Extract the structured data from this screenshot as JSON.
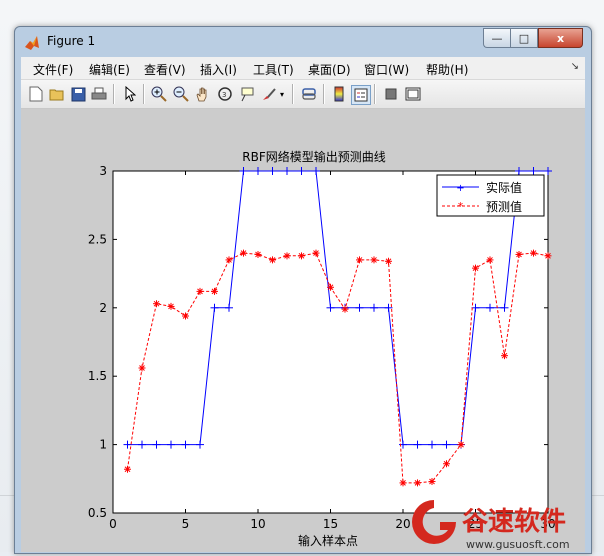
{
  "window": {
    "title": "Figure 1",
    "controls": {
      "minimize": "—",
      "maximize": "□",
      "close": "x"
    }
  },
  "menubar": {
    "items": [
      {
        "label": "文件(F)"
      },
      {
        "label": "编辑(E)"
      },
      {
        "label": "查看(V)"
      },
      {
        "label": "插入(I)"
      },
      {
        "label": "工具(T)"
      },
      {
        "label": "桌面(D)"
      },
      {
        "label": "窗口(W)"
      },
      {
        "label": "帮助(H)"
      }
    ],
    "overflow": "↘"
  },
  "toolbar": {
    "icons": [
      "new-file-icon",
      "open-icon",
      "save-icon",
      "print-icon",
      "pointer-icon",
      "zoom-in-icon",
      "zoom-out-icon",
      "pan-hand-icon",
      "rotate-3d-icon",
      "data-cursor-icon",
      "brush-icon",
      "link-icon",
      "colorbar-icon",
      "legend-icon",
      "hide-plot-tools-icon",
      "show-plot-tools-icon"
    ]
  },
  "watermark": {
    "brand": "谷速软件",
    "url": "www.gusuosft.com"
  },
  "chart_data": {
    "type": "line",
    "title": "RBF网络模型输出预测曲线",
    "xlabel": "输入样本点",
    "ylabel": "",
    "xlim": [
      0,
      30
    ],
    "ylim": [
      0.5,
      3
    ],
    "xticks": [
      "0",
      "5",
      "10",
      "15",
      "20",
      "25",
      "30"
    ],
    "yticks": [
      "0.5",
      "1",
      "1.5",
      "2",
      "2.5",
      "3"
    ],
    "grid": false,
    "legend_position": "top-right",
    "x": [
      1,
      2,
      3,
      4,
      5,
      6,
      7,
      8,
      9,
      10,
      11,
      12,
      13,
      14,
      15,
      16,
      17,
      18,
      19,
      20,
      21,
      22,
      23,
      24,
      25,
      26,
      27,
      28,
      29,
      30
    ],
    "series": [
      {
        "name": "实际值",
        "color": "#0000ff",
        "style": "solid",
        "marker": "+",
        "values": [
          1,
          1,
          1,
          1,
          1,
          1,
          2,
          2,
          3,
          3,
          3,
          3,
          3,
          3,
          2,
          2,
          2,
          2,
          2,
          1,
          1,
          1,
          1,
          1,
          2,
          2,
          2,
          3,
          3,
          3
        ]
      },
      {
        "name": "预测值",
        "color": "#ff0000",
        "style": "dashed",
        "marker": "*",
        "values": [
          0.82,
          1.56,
          2.03,
          2.01,
          1.94,
          2.12,
          2.12,
          2.35,
          2.4,
          2.39,
          2.35,
          2.38,
          2.38,
          2.4,
          2.15,
          1.99,
          2.35,
          2.35,
          2.34,
          0.72,
          0.72,
          0.73,
          0.86,
          1.0,
          2.29,
          2.35,
          1.65,
          2.39,
          2.4,
          2.38
        ]
      }
    ]
  }
}
